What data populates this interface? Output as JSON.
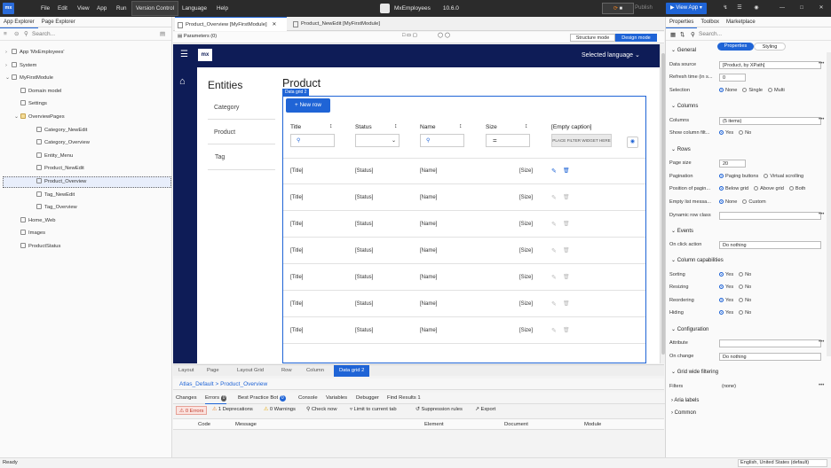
{
  "titlebar": {
    "logo": "mx",
    "menu": [
      "File",
      "Edit",
      "View",
      "App",
      "Run",
      "Version Control",
      "Language",
      "Help"
    ],
    "app_name": "MxEmployees",
    "version": "10.6.0",
    "publish": "Publish",
    "view_app": "View App"
  },
  "left": {
    "tabs": [
      "App Explorer",
      "Page Explorer"
    ],
    "search_placeholder": "Search...",
    "tree": [
      {
        "label": "App 'MxEmployees'",
        "indent": 0
      },
      {
        "label": "System",
        "indent": 0
      },
      {
        "label": "MyFirstModule",
        "indent": 0
      },
      {
        "label": "Domain model",
        "indent": 1
      },
      {
        "label": "Settings",
        "indent": 1
      },
      {
        "label": "OverviewPages",
        "indent": 1
      },
      {
        "label": "Category_NewEdit",
        "indent": 2
      },
      {
        "label": "Category_Overview",
        "indent": 2
      },
      {
        "label": "Entity_Menu",
        "indent": 2
      },
      {
        "label": "Product_NewEdit",
        "indent": 2
      },
      {
        "label": "Product_Overview",
        "indent": 2
      },
      {
        "label": "Tag_NewEdit",
        "indent": 2
      },
      {
        "label": "Tag_Overview",
        "indent": 2
      },
      {
        "label": "Home_Web",
        "indent": 1
      },
      {
        "label": "Images",
        "indent": 1
      },
      {
        "label": "ProductStatus",
        "indent": 1
      }
    ]
  },
  "doctabs": [
    "Product_Overview [MyFirstModule]",
    "Product_NewEdit [MyFirstModule]"
  ],
  "toolbar": {
    "params": "Parameters (0)",
    "structure": "Structure mode",
    "design": "Design mode"
  },
  "canvas": {
    "logo": "mx",
    "lang": "Selected language",
    "entities_title": "Entities",
    "menu": [
      "Category",
      "Product",
      "Tag"
    ],
    "page_title": "Product",
    "grid_badge": "Data grid 2",
    "new_row": "+ New row",
    "columns": [
      "Title",
      "Status",
      "Name",
      "Size",
      "[Empty caption]"
    ],
    "place_filter": "PLACE FILTER WIDGET HERE",
    "row_cells": [
      "[Title]",
      "[Status]",
      "[Name]",
      "[Size]"
    ]
  },
  "breadcrumb": [
    "Layout",
    "Page",
    "Layout Grid",
    "Row",
    "Column",
    "Data grid 2"
  ],
  "path": "Atlas_Default > Product_Overview",
  "bottom_tabs": [
    "Changes",
    "Errors",
    "Best Practice Bot",
    "Console",
    "Variables",
    "Debugger",
    "Find Results 1"
  ],
  "error_count": "0",
  "bpb_count": "0",
  "filters": [
    "0 Errors",
    "1 Deprecations",
    "0 Warnings",
    "Check now",
    "Limit to current tab",
    "Suppression rules",
    "Export"
  ],
  "error_cols": [
    "Code",
    "Message",
    "Element",
    "Document",
    "Module"
  ],
  "right": {
    "tabs": [
      "Properties",
      "Toolbox",
      "Marketplace"
    ],
    "search_placeholder": "Search...",
    "subtabs": [
      "Properties",
      "Styling"
    ],
    "general": "General",
    "data_source_label": "Data source",
    "data_source_val": "[Product, by XPath]",
    "refresh_label": "Refresh time (in s...",
    "refresh_val": "0",
    "selection_label": "Selection",
    "selection_opts": [
      "None",
      "Single",
      "Multi"
    ],
    "columns_section": "Columns",
    "columns_label": "Columns",
    "columns_val": "(5 items)",
    "show_filter_label": "Show column filt...",
    "yes": "Yes",
    "no": "No",
    "rows_section": "Rows",
    "pagesize_label": "Page size",
    "pagesize_val": "20",
    "pagination_label": "Pagination",
    "pagination_opts": [
      "Paging buttons",
      "Virtual scrolling"
    ],
    "position_label": "Position of pagin...",
    "position_opts": [
      "Below grid",
      "Above grid",
      "Both"
    ],
    "empty_label": "Empty list messa...",
    "empty_opts": [
      "None",
      "Custom"
    ],
    "dynrow_label": "Dynamic row class",
    "events_section": "Events",
    "onclick_label": "On click action",
    "do_nothing": "Do nothing",
    "colcap_section": "Column capabilities",
    "sorting": "Sorting",
    "resizing": "Resizing",
    "reordering": "Reordering",
    "hiding": "Hiding",
    "config_section": "Configuration",
    "attribute_label": "Attribute",
    "onchange_label": "On change",
    "gridwide_section": "Grid wide filtering",
    "filters_label": "Filters",
    "filters_val": "(none)",
    "aria_section": "Aria labels",
    "common_section": "Common"
  },
  "status": {
    "left": "Ready",
    "right": "English, United States (default)"
  }
}
